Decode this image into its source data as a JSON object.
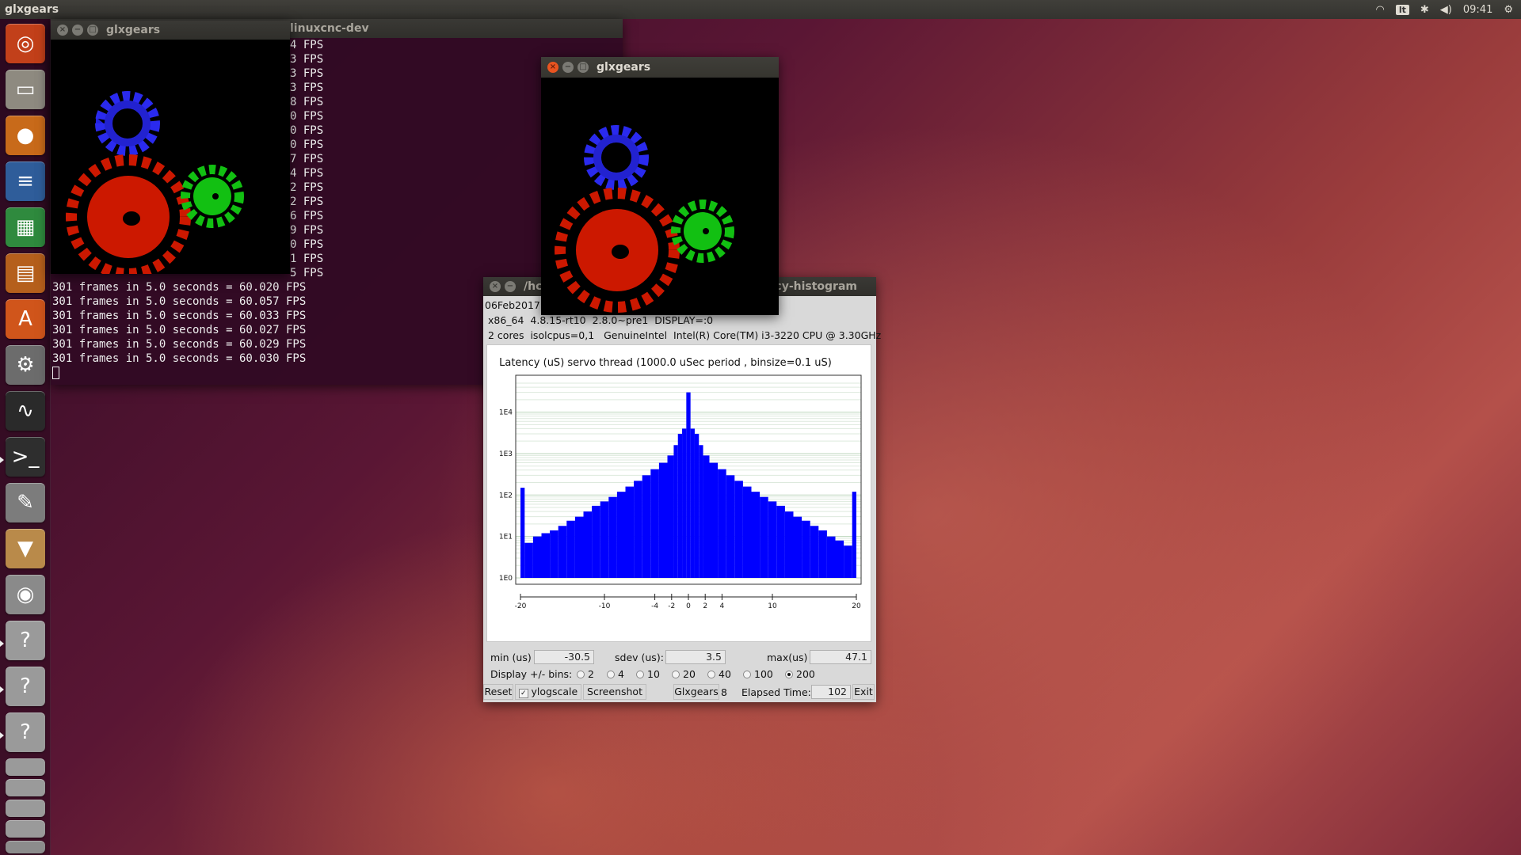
{
  "topbar": {
    "app_title": "glxgears",
    "keyboard": "lt",
    "clock": "09:41"
  },
  "launcher": {
    "items": [
      "ubuntu-logo",
      "files",
      "firefox",
      "writer",
      "calc",
      "impress",
      "software-center",
      "system-settings",
      "system-monitor",
      "terminal",
      "text-editor",
      "archive-manager",
      "screenshot",
      "unknown-app",
      "unknown-app",
      "unknown-app",
      "trash"
    ]
  },
  "terminal": {
    "title": "linuxcnc-dev",
    "partial_lines": [
      "4 FPS",
      "3 FPS",
      "3 FPS",
      "3 FPS",
      "8 FPS",
      "0 FPS",
      "0 FPS",
      "0 FPS",
      "7 FPS",
      "4 FPS",
      "2 FPS",
      "2 FPS",
      "6 FPS",
      "9 FPS",
      "0 FPS",
      "1 FPS",
      "5 FPS"
    ],
    "full_lines": [
      "301 frames in 5.0 seconds = 60.020 FPS",
      "301 frames in 5.0 seconds = 60.057 FPS",
      "301 frames in 5.0 seconds = 60.033 FPS",
      "301 frames in 5.0 seconds = 60.027 FPS",
      "301 frames in 5.0 seconds = 60.029 FPS",
      "301 frames in 5.0 seconds = 60.030 FPS"
    ]
  },
  "glxgears1": {
    "title": "glxgears"
  },
  "glxgears2": {
    "title": "glxgears"
  },
  "histogram": {
    "title_left": "/hc",
    "title_right": "ncy-histogram",
    "date": "06Feb2017",
    "sysinfo1": "x86_64  4.8.15-rt10  2.8.0~pre1  DISPLAY=:0",
    "sysinfo2": "2 cores  isolcpus=0,1   GenuineIntel  Intel(R) Core(TM) i3-3220 CPU @ 3.30GHz",
    "min_label": "min (us)",
    "min_value": "-30.5",
    "sdev_label": "sdev (us):",
    "sdev_value": "3.5",
    "max_label": "max(us)",
    "max_value": "47.1",
    "bins_label": "Display +/- bins:",
    "bins": [
      "2",
      "4",
      "10",
      "20",
      "40",
      "100",
      "200"
    ],
    "bins_selected": "200",
    "reset": "Reset",
    "ylog": "ylogscale",
    "screenshot": "Screenshot",
    "glxgears": "Glxgears",
    "glxgears_count": "8",
    "elapsed_label": "Elapsed Time:",
    "elapsed_value": "102",
    "exit": "Exit"
  },
  "chart_data": {
    "type": "bar",
    "title": "Latency (uS) servo thread (1000.0 uSec period , binsize=0.1 uS)",
    "xlabel": "",
    "ylabel": "",
    "xlim": [
      -20,
      20
    ],
    "x_ticks": [
      "-20",
      "-10",
      "-4",
      "-2",
      "0",
      "2",
      "4",
      "10",
      "20"
    ],
    "y_scale": "log",
    "y_ticks": [
      "1E0",
      "1E1",
      "1E2",
      "1E3",
      "1E4"
    ],
    "ylim": [
      1,
      50000
    ],
    "color": "#0000ff",
    "grid": true,
    "x": [
      -20,
      -19,
      -18,
      -17,
      -16,
      -15,
      -14,
      -13,
      -12,
      -11,
      -10,
      -9,
      -8,
      -7,
      -6,
      -5,
      -4,
      -3,
      -2,
      -1.5,
      -1,
      -0.5,
      0,
      0.5,
      1,
      1.5,
      2,
      3,
      4,
      5,
      6,
      7,
      8,
      9,
      10,
      11,
      12,
      13,
      14,
      15,
      16,
      17,
      18,
      19,
      20
    ],
    "values": [
      150,
      7,
      10,
      12,
      14,
      18,
      24,
      30,
      40,
      55,
      70,
      90,
      120,
      160,
      220,
      300,
      420,
      600,
      900,
      1600,
      3000,
      4000,
      30000,
      4000,
      3000,
      1600,
      900,
      600,
      420,
      300,
      220,
      160,
      120,
      90,
      70,
      55,
      40,
      30,
      24,
      18,
      14,
      10,
      8,
      6,
      120
    ]
  }
}
